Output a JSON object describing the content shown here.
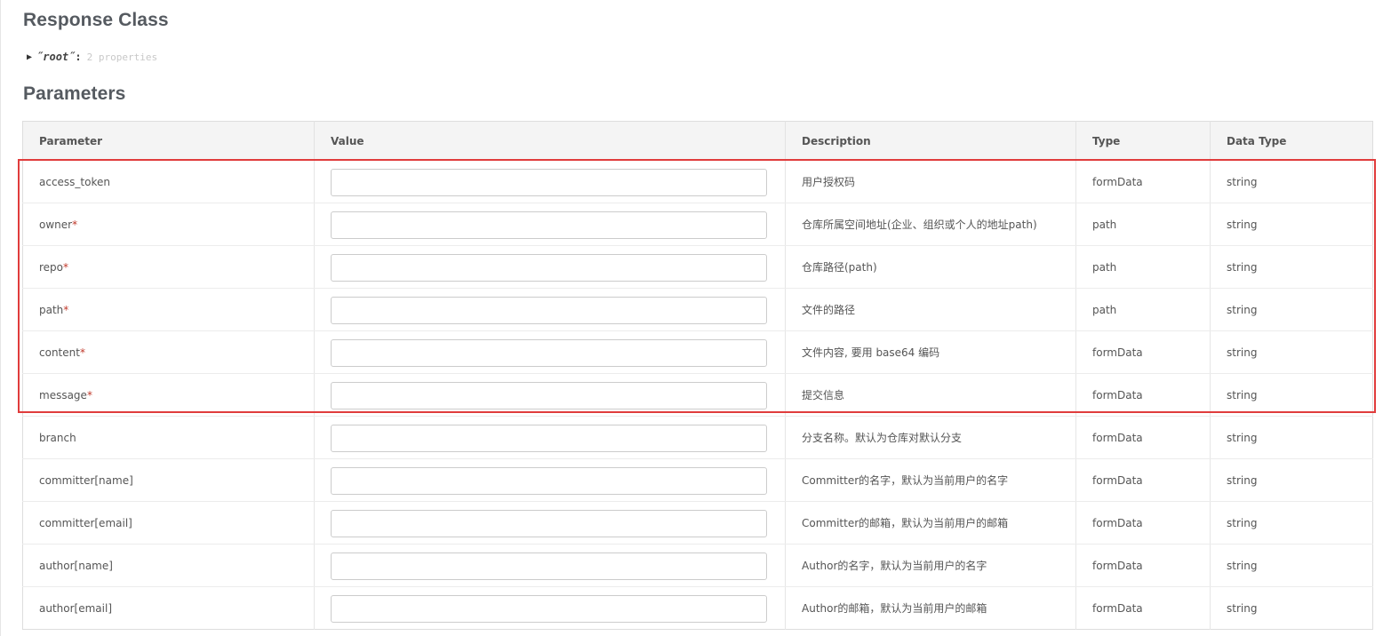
{
  "response_class": {
    "title": "Response Class",
    "model": {
      "toggle_icon": "triangle-right-icon",
      "key": "˝root˝",
      "colon": ":",
      "summary": "2 properties"
    }
  },
  "parameters": {
    "title": "Parameters",
    "columns": [
      "Parameter",
      "Value",
      "Description",
      "Type",
      "Data Type"
    ],
    "required_marker": "*",
    "rows": [
      {
        "name": "access_token",
        "required": false,
        "value": "",
        "description": "用户授权码",
        "type": "formData",
        "data_type": "string"
      },
      {
        "name": "owner",
        "required": true,
        "value": "",
        "description": "仓库所属空间地址(企业、组织或个人的地址path)",
        "type": "path",
        "data_type": "string"
      },
      {
        "name": "repo",
        "required": true,
        "value": "",
        "description": "仓库路径(path)",
        "type": "path",
        "data_type": "string"
      },
      {
        "name": "path",
        "required": true,
        "value": "",
        "description": "文件的路径",
        "type": "path",
        "data_type": "string"
      },
      {
        "name": "content",
        "required": true,
        "value": "",
        "description": "文件内容, 要用 base64 编码",
        "type": "formData",
        "data_type": "string"
      },
      {
        "name": "message",
        "required": true,
        "value": "",
        "description": "提交信息",
        "type": "formData",
        "data_type": "string"
      },
      {
        "name": "branch",
        "required": false,
        "value": "",
        "description": "分支名称。默认为仓库对默认分支",
        "type": "formData",
        "data_type": "string"
      },
      {
        "name": "committer[name]",
        "required": false,
        "value": "",
        "description": "Committer的名字，默认为当前用户的名字",
        "type": "formData",
        "data_type": "string"
      },
      {
        "name": "committer[email]",
        "required": false,
        "value": "",
        "description": "Committer的邮箱，默认为当前用户的邮箱",
        "type": "formData",
        "data_type": "string"
      },
      {
        "name": "author[name]",
        "required": false,
        "value": "",
        "description": "Author的名字，默认为当前用户的名字",
        "type": "formData",
        "data_type": "string"
      },
      {
        "name": "author[email]",
        "required": false,
        "value": "",
        "description": "Author的邮箱，默认为当前用户的邮箱",
        "type": "formData",
        "data_type": "string"
      }
    ]
  },
  "annotation": {
    "highlight_color": "#e03c3c"
  }
}
